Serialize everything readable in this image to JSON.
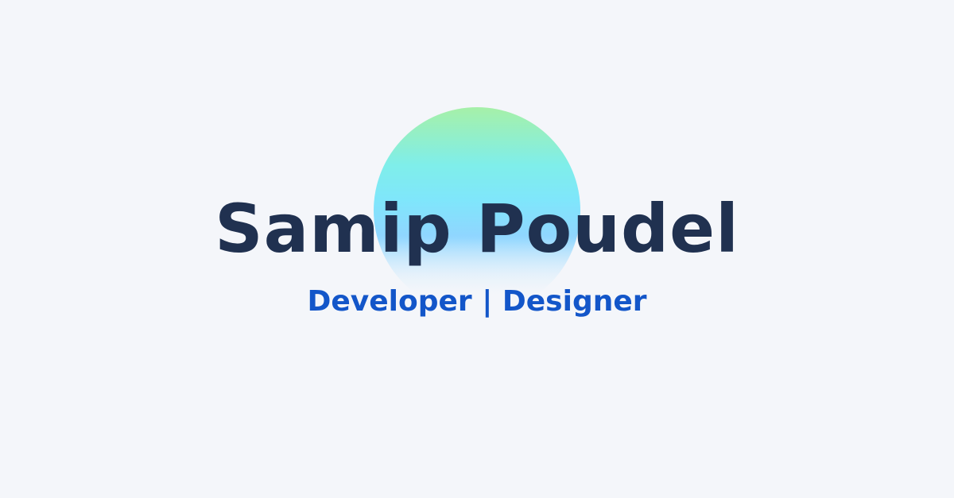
{
  "hero": {
    "name": "Samip Poudel",
    "tagline": "Developer | Designer"
  },
  "colors": {
    "background": "#f4f6fa",
    "name": "#203150",
    "tagline": "#1356c9",
    "gradient_top": "#a6f0a8",
    "gradient_mid": "#7fe6fb",
    "gradient_bottom": "#cdeafc"
  }
}
